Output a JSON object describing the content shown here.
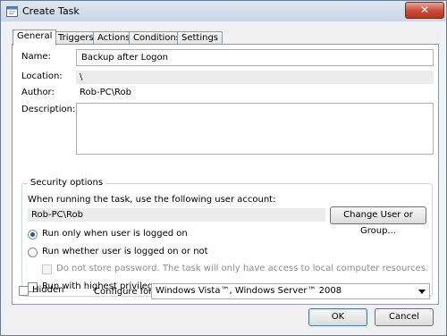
{
  "window": {
    "title": "Create Task",
    "close_label": "✕"
  },
  "tabs": [
    "General",
    "Triggers",
    "Actions",
    "Conditions",
    "Settings"
  ],
  "general": {
    "name_label": "Name:",
    "name_value": "Backup after Logon",
    "location_label": "Location:",
    "location_value": "\\",
    "author_label": "Author:",
    "author_value": "Rob-PC\\Rob",
    "description_label": "Description:",
    "description_value": ""
  },
  "security": {
    "group_title": "Security options",
    "account_prompt": "When running the task, use the following user account:",
    "account_value": "Rob-PC\\Rob",
    "change_button": "Change User or Group...",
    "radio_logged_on": "Run only when user is logged on",
    "radio_whether": "Run whether user is logged on or not",
    "no_store_password": "Do not store password.  The task will only have access to local computer resources.",
    "highest_privileges": "Run with highest privileges"
  },
  "bottom": {
    "hidden_label": "Hidden",
    "configure_label": "Configure for:",
    "configure_value": "Windows Vista™, Windows Server™ 2008"
  },
  "buttons": {
    "ok": "OK",
    "cancel": "Cancel"
  }
}
